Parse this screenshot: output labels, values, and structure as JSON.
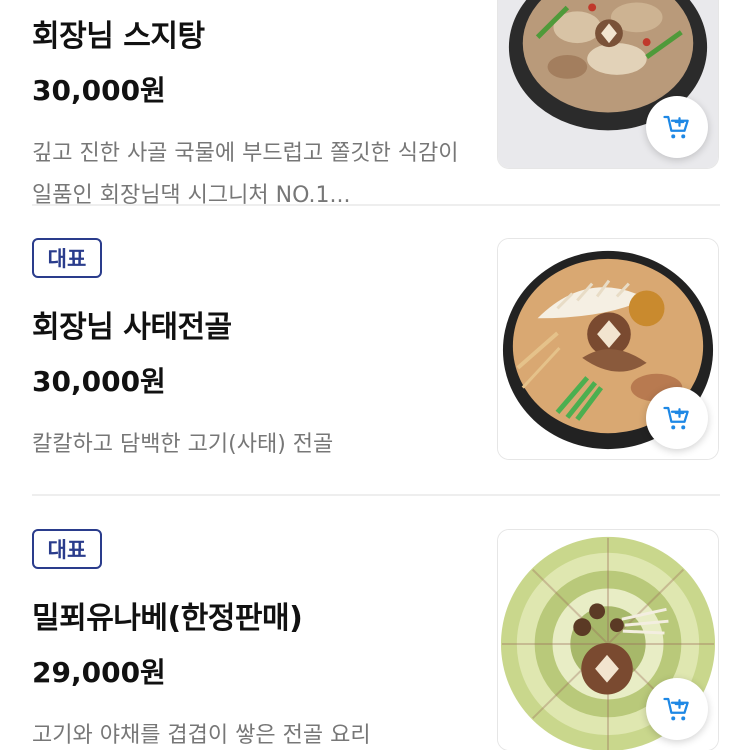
{
  "accent_color": "#2a3c8c",
  "cart_icon_color": "#1e88e5",
  "items": [
    {
      "name": "회장님 스지탕",
      "price": "30,000원",
      "description": "깊고 진한 사골 국물에 부드럽고 쫄깃한 식감이 일품인 회장님댁 시그니처 NO.1...",
      "image": "hotpot-suji-photo",
      "cart_icon": "add-to-cart-icon"
    },
    {
      "badge": "대표",
      "name": "회장님 사태전골",
      "price": "30,000원",
      "description": "칼칼하고 담백한 고기(사태) 전골",
      "image": "hotpot-beef-shank-photo",
      "cart_icon": "add-to-cart-icon"
    },
    {
      "badge": "대표",
      "name": "밀푀유나베(한정판매)",
      "price": "29,000원",
      "description": "고기와 야채를 겹겹이 쌓은 전골 요리",
      "image": "millefeuille-nabe-photo",
      "cart_icon": "add-to-cart-icon"
    }
  ]
}
